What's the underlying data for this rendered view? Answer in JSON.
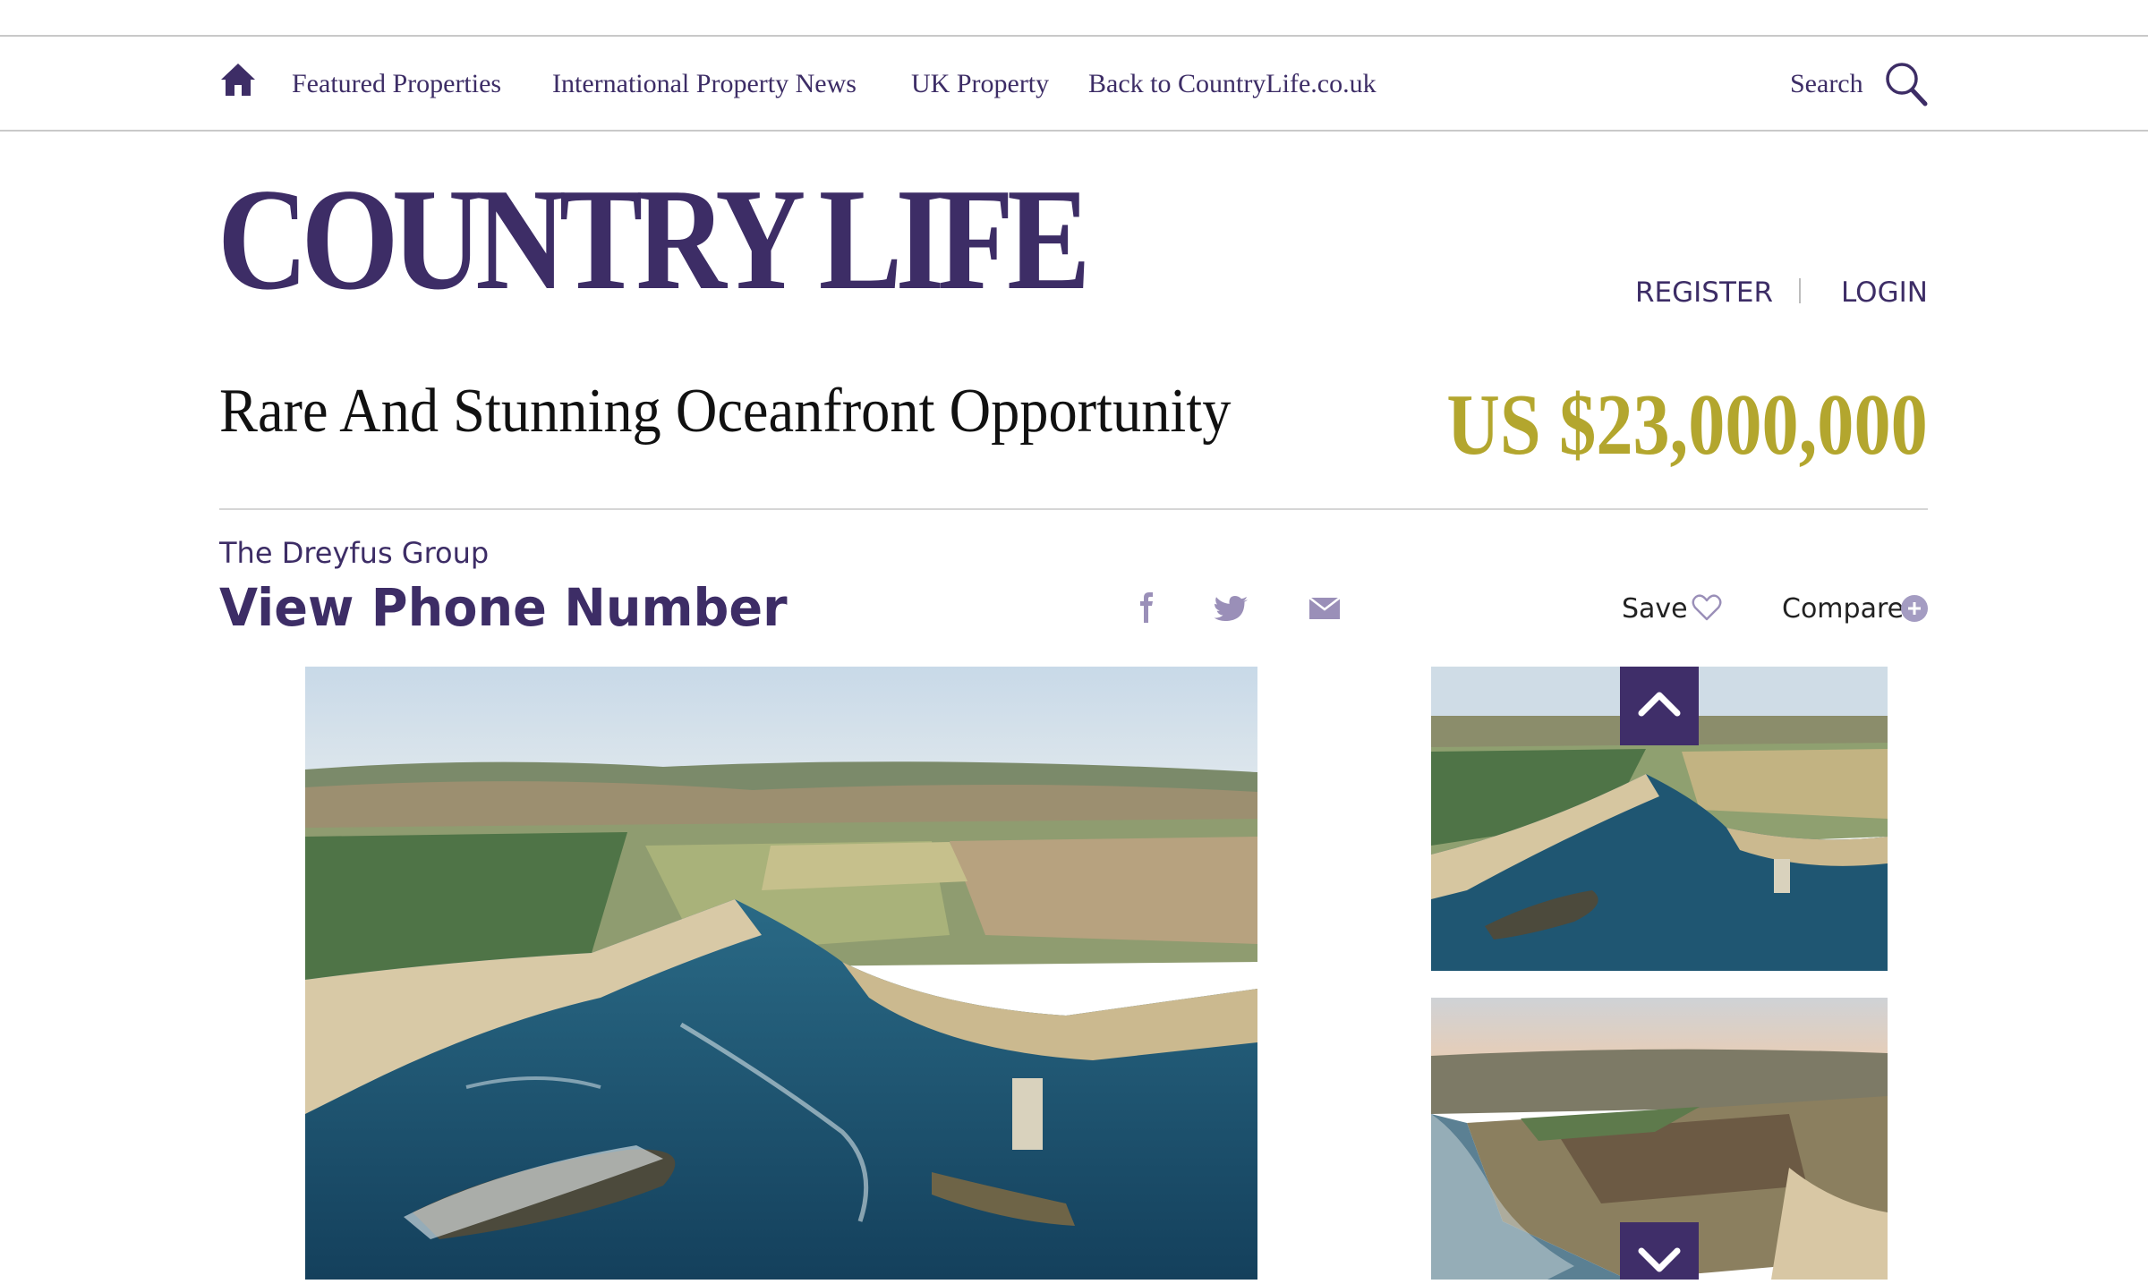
{
  "nav": {
    "home_icon": "home-icon",
    "links": [
      "Featured Properties",
      "International Property News",
      "UK Property",
      "Back to CountryLife.co.uk"
    ],
    "search_label": "Search",
    "search_icon": "search-icon"
  },
  "header": {
    "logo": "COUNTRY LIFE",
    "register": "REGISTER",
    "login": "LOGIN"
  },
  "listing": {
    "title": "Rare And Stunning Oceanfront Opportunity",
    "price": "US $23,000,000",
    "agent": "The Dreyfus Group",
    "phone_link": "View Phone Number",
    "share_icons": [
      "facebook-icon",
      "twitter-icon",
      "email-icon"
    ],
    "save_label": "Save",
    "compare_label": "Compare"
  },
  "gallery": {
    "main_photo": "aerial-coastline-photo",
    "thumbnails": [
      "aerial-coastline-thumbnail",
      "aerial-farmland-thumbnail"
    ],
    "scroll_icons": [
      "chevron-up-icon",
      "chevron-down-icon"
    ]
  },
  "colors": {
    "brand": "#3d2d66",
    "price": "#b3a62e",
    "arrow_button": "#3f2e69"
  }
}
